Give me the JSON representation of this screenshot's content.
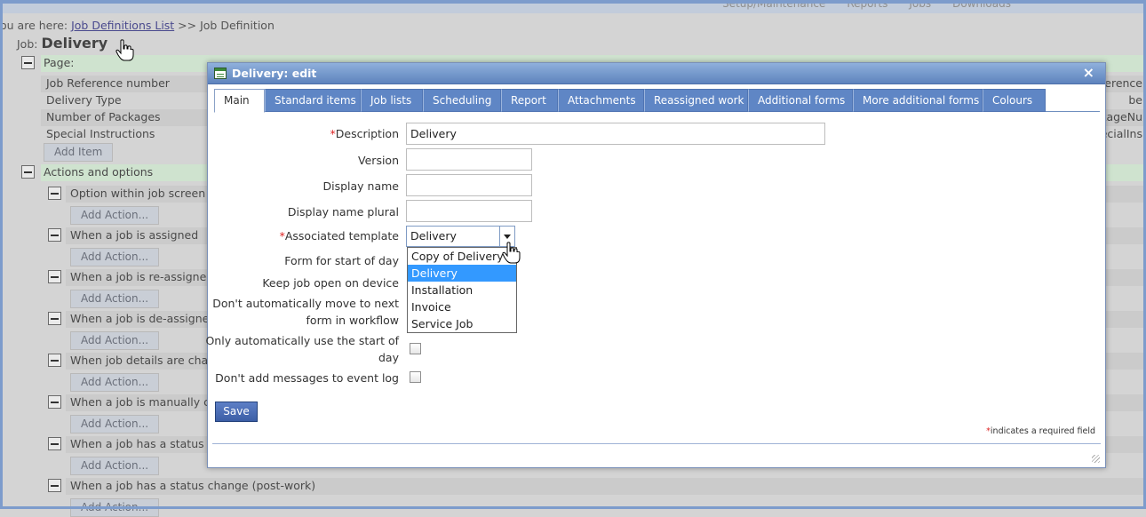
{
  "topnav": {
    "links": [
      "Setup/Maintenance",
      "Reports",
      "Jobs",
      "Downloads"
    ]
  },
  "breadcrumb": {
    "prefix": "ou are here: ",
    "link": "Job Definitions List",
    "sep_current": " >> Job Definition"
  },
  "job": {
    "label": "Job: ",
    "name": "Delivery"
  },
  "page_section": {
    "title": "Page:",
    "items": [
      "Job Reference number",
      "Delivery Type",
      "Number of Packages",
      "Special Instructions"
    ],
    "right_fragments": [
      "eference",
      "be",
      "ckageNu",
      "ecialIns"
    ],
    "add_item": "Add Item"
  },
  "actions_section": {
    "title": "Actions and options",
    "items": [
      "Option within job screen",
      "When a job is assigned",
      "When a job is re-assigned",
      "When a job is de-assigned",
      "When job details are chang",
      "When a job is manually clo",
      "When a job has a status ch",
      "When a job has a status change (post-work)"
    ],
    "add_action": "Add Action..."
  },
  "dialog": {
    "title": "Delivery: edit",
    "close": "×",
    "tabs": [
      "Main",
      "Standard items",
      "Job lists",
      "Scheduling",
      "Report",
      "Attachments",
      "Reassigned work",
      "Additional forms",
      "More additional forms",
      "Colours"
    ],
    "active_tab": "Main",
    "fields": {
      "description": {
        "label": "Description",
        "required": "*",
        "value": "Delivery"
      },
      "version": {
        "label": "Version",
        "value": ""
      },
      "display_name": {
        "label": "Display name",
        "value": ""
      },
      "display_name_plural": {
        "label": "Display name plural",
        "value": ""
      },
      "associated_template": {
        "label": "Associated template",
        "required": "*",
        "value": "Delivery",
        "options": [
          "Copy of Delivery",
          "Delivery",
          "Installation",
          "Invoice",
          "Service Job"
        ],
        "highlighted": "Delivery"
      },
      "form_start_of_day": {
        "label": "Form for start of day"
      },
      "keep_job_open": {
        "label": "Keep job open on device"
      },
      "dont_auto_move": {
        "label_line1": "Don't automatically move to next",
        "label_line2": "form in workflow"
      },
      "only_auto_start": {
        "label_line1": "Only automatically use the start of",
        "label_line2": "day",
        "checked": false
      },
      "dont_add_messages": {
        "label": "Don't add messages to event log",
        "checked": false
      }
    },
    "save": "Save",
    "required_note": {
      "star": "*",
      "text": "indicates a required field"
    }
  }
}
